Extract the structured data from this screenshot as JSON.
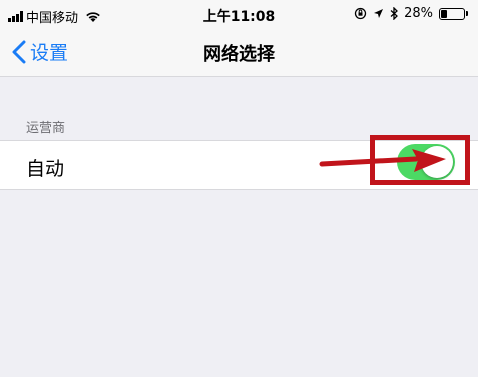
{
  "status_bar": {
    "carrier": "中国移动",
    "time": "上午11:08",
    "battery_percent": "28%",
    "battery_level": 0.28
  },
  "nav": {
    "back_label": "设置",
    "title": "网络选择"
  },
  "section": {
    "header": "运营商",
    "rows": [
      {
        "label": "自动",
        "toggle_on": true
      }
    ]
  },
  "colors": {
    "accent": "#1a7cf5",
    "toggle_on": "#4cd964",
    "annotation": "#c1141b"
  }
}
